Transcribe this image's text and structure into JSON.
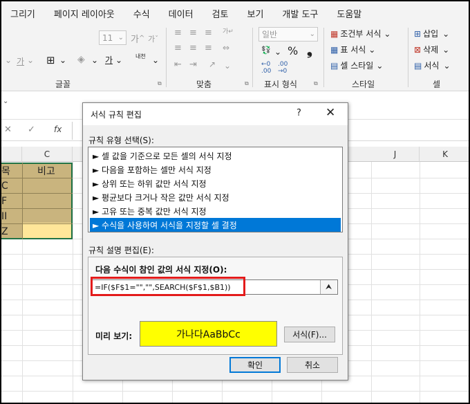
{
  "menu": {
    "tabs": [
      "그리기",
      "페이지 레이아웃",
      "수식",
      "데이터",
      "검토",
      "보기",
      "개발 도구",
      "도움말"
    ]
  },
  "ribbon": {
    "font_size": "11",
    "grow_font": "가",
    "shrink_font": "가",
    "font_color_glyph": "가",
    "underline_glyph": "가",
    "korean_rotate": "내천",
    "number_format": "일반",
    "percent": "%",
    "comma": "❟",
    "cond_format": "조건부 서식",
    "table_format": "표 서식",
    "cell_style": "셀 스타일",
    "insert": "삽입",
    "delete": "삭제",
    "format": "서식",
    "group_font": "글꼴",
    "group_align": "맞춤",
    "group_number": "표시 형식",
    "group_style": "스타일",
    "group_cell": "셀"
  },
  "formula_bar": {
    "fx": "fx",
    "cancel": "✕",
    "enter": "✓"
  },
  "grid": {
    "columns": [
      "C",
      "J",
      "K"
    ],
    "cells": [
      "목",
      "비고",
      "C",
      "F",
      "II",
      "Z"
    ],
    "highlight_color": "#c9b47e",
    "active_cell_color": "#ffe699"
  },
  "dialog": {
    "title": "서식 규칙 편집",
    "help": "?",
    "close": "✕",
    "rule_type_label": "규칙 유형 선택(S):",
    "rule_types": [
      "► 셀 값을 기준으로 모든 셀의 서식 지정",
      "► 다음을 포함하는 셀만 서식 지정",
      "► 상위 또는 하위 값만 서식 지정",
      "► 평균보다 크거나 작은 값만 서식 지정",
      "► 고유 또는 중복 값만 서식 지정",
      "► 수식을 사용하여 서식을 지정할 셀 결정"
    ],
    "rule_desc_label": "규칙 설명 편집(E):",
    "formula_label": "다음 수식이 참인 값의 서식 지정(O):",
    "formula": "=IF($F$1=\"\",\"\",SEARCH($F$1,$B1))",
    "preview_label": "미리 보기:",
    "preview_text": "가나다AaBbCc",
    "preview_color": "#ffff00",
    "format_button": "서식(F)...",
    "ok": "확인",
    "cancel": "취소"
  }
}
